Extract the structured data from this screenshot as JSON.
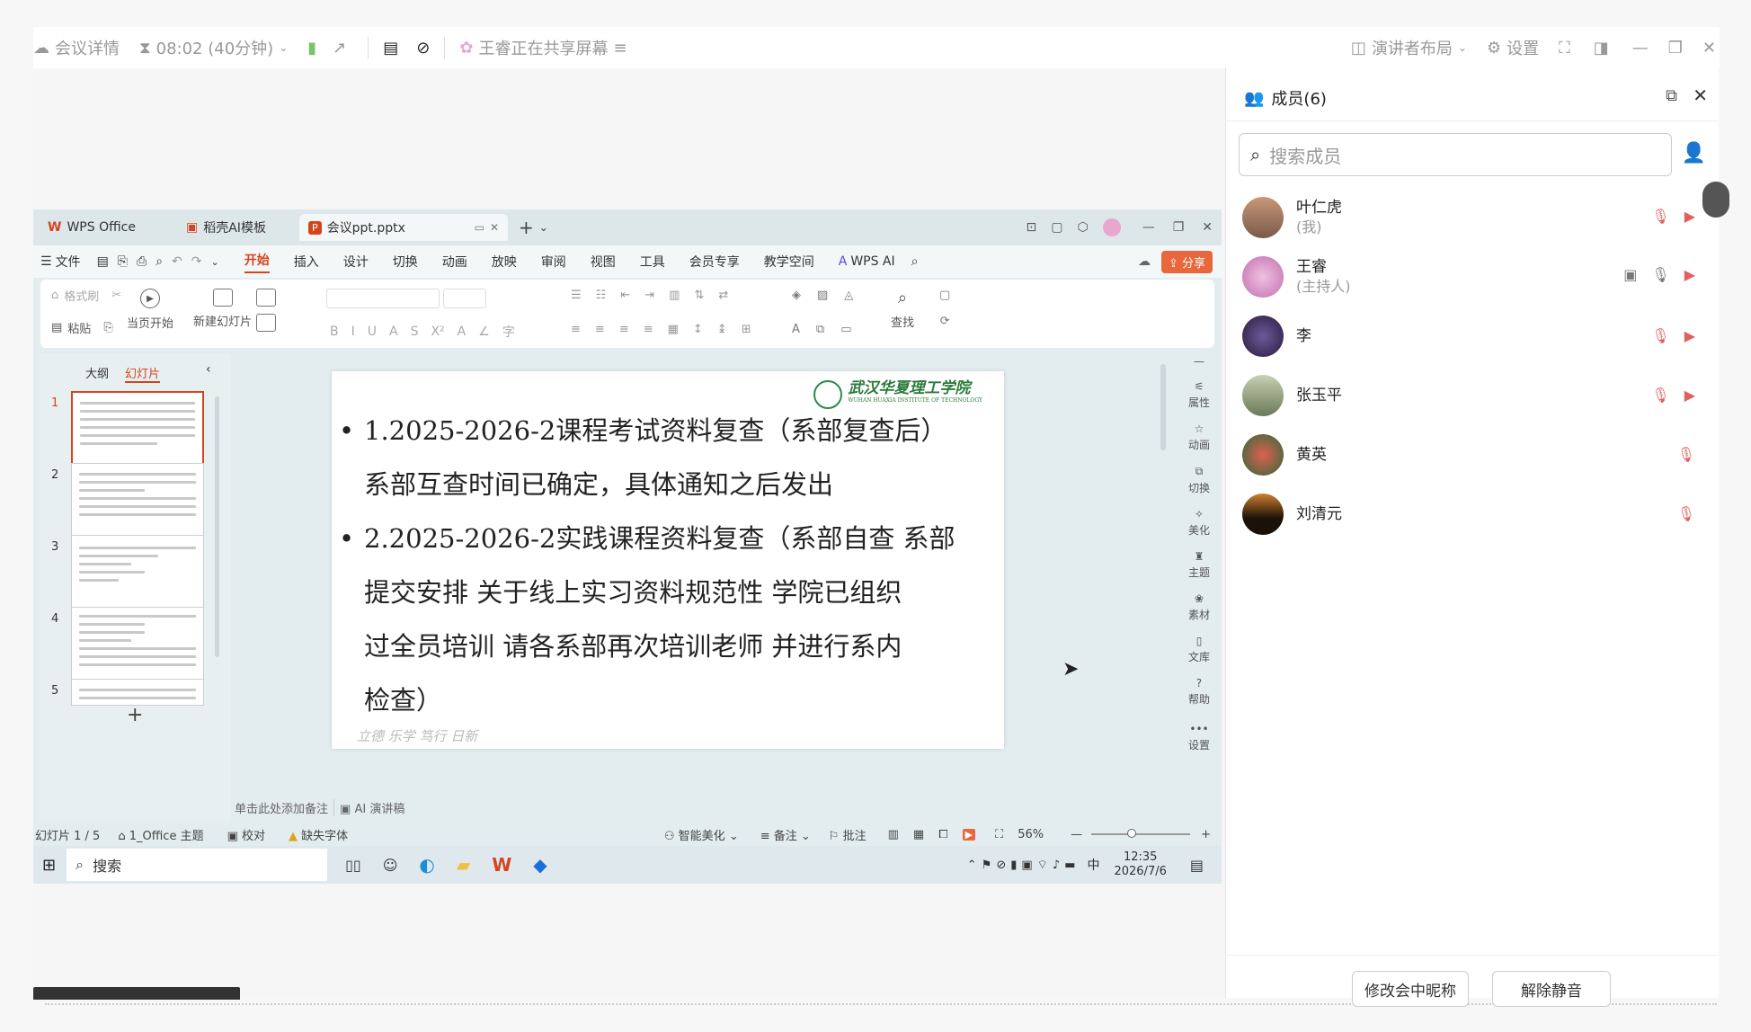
{
  "topbar": {
    "meeting_details": "会议详情",
    "timer": "08:02 (40分钟)",
    "sharing_status": "王睿正在共享屏幕",
    "layout": "演讲者布局",
    "settings": "设置"
  },
  "wps": {
    "tabs": [
      "WPS Office",
      "稻壳AI模板",
      "会议ppt.pptx"
    ],
    "menu": [
      "文件",
      "开始",
      "插入",
      "设计",
      "切换",
      "动画",
      "放映",
      "审阅",
      "视图",
      "工具",
      "会员专享",
      "教学空间",
      "WPS AI"
    ],
    "active_menu": "开始",
    "share": "分享",
    "ribbon": {
      "format_painter": "格式刷",
      "paste": "粘贴",
      "from_current": "当页开始",
      "new_slide": "新建幻灯片",
      "find": "查找"
    },
    "panel_tabs": [
      "大纲",
      "幻灯片"
    ],
    "slide_numbers": [
      "1",
      "2",
      "3",
      "4",
      "5"
    ],
    "slide": {
      "logo_cn": "武汉华夏理工学院",
      "logo_en": "WUHAN HUAXIA INSTITUTE OF TECHNOLOGY",
      "bullets": [
        [
          "1.2025-2026-2课程考试资料复查（系部复查后）",
          "系部互查时间已确定，具体通知之后发出"
        ],
        [
          "2.2025-2026-2实践课程资料复查（系部自查 系部",
          "提交安排 关于线上实习资料规范性 学院已组织",
          "过全员培训 请各系部再次培训老师 并进行系内",
          "检查）"
        ]
      ],
      "motto": "立德  乐学  笃行  日新"
    },
    "right_tools": [
      "属性",
      "动画",
      "切换",
      "美化",
      "主题",
      "素材",
      "文库",
      "帮助",
      "设置"
    ],
    "notes_placeholder": "单击此处添加备注",
    "ai_notes": "AI 演讲稿",
    "status": {
      "slide_count": "幻灯片 1 / 5",
      "theme": "1_Office 主题",
      "proof": "校对",
      "missing_font": "缺失字体",
      "smart": "智能美化",
      "notes": "备注",
      "comments": "批注",
      "zoom": "56%"
    },
    "taskbar": {
      "search": "搜索",
      "ime": "中",
      "time": "12:35",
      "date": "2026/7/6"
    }
  },
  "sidebar": {
    "title": "成员(6)",
    "search_placeholder": "搜索成员",
    "members": [
      {
        "name": "叶仁虎",
        "role": "(我)",
        "color": "#b98a6a"
      },
      {
        "name": "王睿",
        "role": "(主持人)",
        "color": "#e9a7d0"
      },
      {
        "name": "李",
        "role": "",
        "color": "#4a3a6a"
      },
      {
        "name": "张玉平",
        "role": "",
        "color": "#9aa87a"
      },
      {
        "name": "黄英",
        "role": "",
        "color": "#c44a3a"
      },
      {
        "name": "刘清元",
        "role": "",
        "color": "#3a2a1a"
      }
    ],
    "rename_button": "修改会中昵称",
    "unmute_button": "解除静音"
  }
}
